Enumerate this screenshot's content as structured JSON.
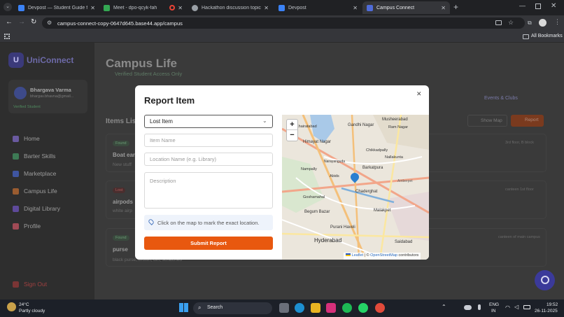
{
  "browser": {
    "tabs": [
      {
        "title": "Devpost — Student Guide for H",
        "icon_color": "#3b82f6",
        "active": false
      },
      {
        "title": "Meet - dpo-qcyk-fah",
        "icon_color": "#34a853",
        "active": false
      },
      {
        "title": "",
        "icon_color": "#ea4335",
        "active": false
      },
      {
        "title": "Hackathon discussion topics",
        "icon_color": "#9aa0a6",
        "active": false
      },
      {
        "title": "Devpost",
        "icon_color": "#3b82f6",
        "active": false
      },
      {
        "title": "Campus Connect",
        "icon_color": "#4f6bd8",
        "active": true
      }
    ],
    "url": "campus-connect-copy-0647d645.base44.app/campus",
    "bookmarks_label": "All Bookmarks"
  },
  "sidebar": {
    "brand": "UniConnect",
    "brand_letter": "U",
    "user": {
      "name": "Bhargava Varma",
      "email": "bhargav.bhavna@gmail...",
      "badge": "Verified Student"
    },
    "items": [
      {
        "label": "Home",
        "color": "#8a6be0"
      },
      {
        "label": "Barter Skills",
        "color": "#3fa56a"
      },
      {
        "label": "Marketplace",
        "color": "#4f6bd8"
      },
      {
        "label": "Campus Life",
        "color": "#c9763a"
      },
      {
        "label": "Digital Library",
        "color": "#7a5dc8"
      },
      {
        "label": "Profile",
        "color": "#d05a6a"
      }
    ],
    "signout": "Sign Out"
  },
  "main": {
    "title": "Campus Life",
    "subtitle": "Verified Student Access Only",
    "tab_right": "Events & Clubs",
    "items_heading": "Items Lis",
    "show_map": "Show Map",
    "report": "Report",
    "items": [
      {
        "badge": "Found",
        "title": "Boat ear",
        "desc": "New stuff",
        "location": "3rd floor, B block"
      },
      {
        "badge": "Lost",
        "title": "airpods",
        "desc": "white airp",
        "location": "canteen 1st floor"
      },
      {
        "badge": "Found",
        "title": "purse",
        "desc": "black purse, brown, dirt, scratched",
        "location": "canteen of main campus"
      }
    ]
  },
  "modal": {
    "title": "Report Item",
    "type_value": "Lost Item",
    "item_name_placeholder": "Item Name",
    "location_placeholder": "Location Name (e.g. Library)",
    "description_placeholder": "Description",
    "hint": "Click on the map to mark the exact location.",
    "submit": "Submit Report",
    "zoom_in": "+",
    "zoom_out": "−",
    "attribution_leaflet": "Leaflet",
    "attribution_osm": "OpenStreetMap",
    "attribution_rest": "contributors",
    "map_labels": [
      "Musheerabad",
      "Gandhi Nagar",
      "Ram Nagar",
      "Khairatabad",
      "Himayat Nagar",
      "Chikkadpally",
      "Nallakunta",
      "Barkatpura",
      "Narayanguda",
      "Nampally",
      "Abids",
      "Chaderghat",
      "Amberpet",
      "Goshamahal",
      "Malakpet",
      "Begum Bazar",
      "Purani Haveli",
      "Hyderabad",
      "Saidabad"
    ]
  },
  "taskbar": {
    "weather_temp": "24°C",
    "weather_desc": "Partly cloudy",
    "search": "Search",
    "lang": "ENG",
    "lang2": "IN",
    "time": "19:52",
    "date": "26-11-2025"
  }
}
